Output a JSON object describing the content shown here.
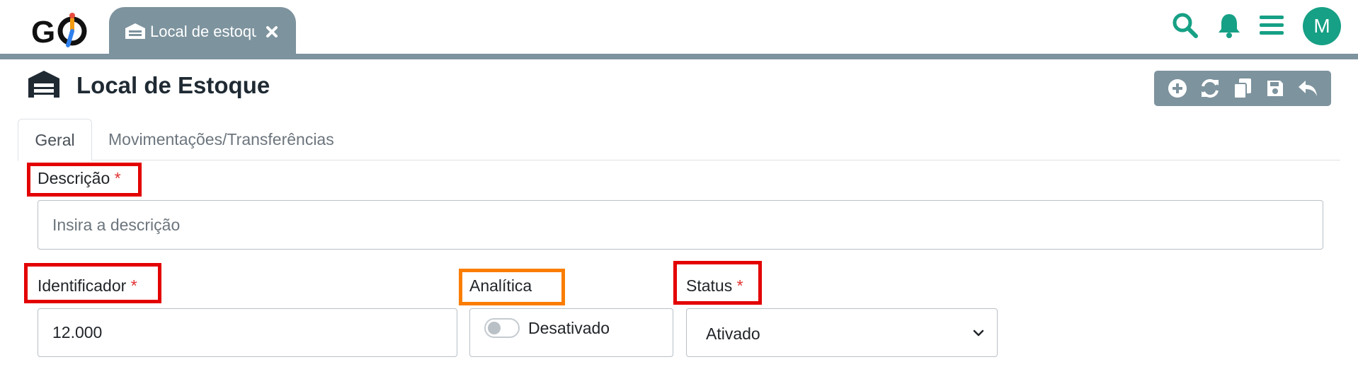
{
  "app": {
    "logo_text": "GO",
    "open_tab": {
      "label": "Local de estoque",
      "close_icon": "close-icon",
      "icon": "warehouse-icon"
    },
    "top_icons": [
      "search-icon",
      "bell-icon",
      "menu-icon"
    ],
    "avatar_initial": "M",
    "colors": {
      "accent": "#16a085",
      "bar": "#7d939e",
      "required": "#e03131",
      "highlight_red": "#e30000",
      "highlight_orange": "#fa7d00"
    }
  },
  "page": {
    "title": "Local de Estoque",
    "icon": "warehouse-icon",
    "toolbar": [
      "add-icon",
      "refresh-icon",
      "copy-icon",
      "save-icon",
      "undo-icon"
    ]
  },
  "tabs": [
    {
      "label": "Geral",
      "active": true
    },
    {
      "label": "Movimentações/Transferências",
      "active": false
    }
  ],
  "form": {
    "descricao": {
      "label": "Descrição",
      "required_mark": "*",
      "placeholder": "Insira a descrição",
      "value": ""
    },
    "identificador": {
      "label": "Identificador",
      "required_mark": "*",
      "value": "12.000"
    },
    "analitica": {
      "label": "Analítica",
      "switch_label": "Desativado",
      "checked": false
    },
    "status": {
      "label": "Status",
      "required_mark": "*",
      "value": "Ativado"
    }
  }
}
